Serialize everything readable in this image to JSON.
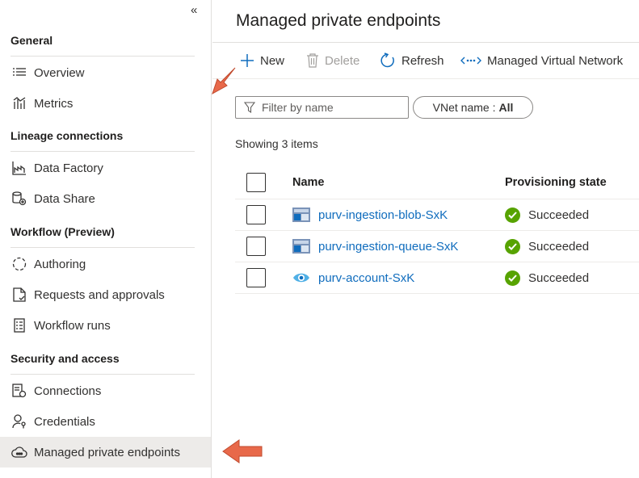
{
  "sidebar": {
    "collapse_glyph": "«",
    "sections": [
      {
        "title": "General"
      },
      {
        "title": "Lineage connections"
      },
      {
        "title": "Workflow (Preview)"
      },
      {
        "title": "Security and access"
      }
    ],
    "items": [
      {
        "label": "Overview",
        "icon": "list-icon"
      },
      {
        "label": "Metrics",
        "icon": "metrics-icon"
      },
      {
        "label": "Data Factory",
        "icon": "data-factory-icon"
      },
      {
        "label": "Data Share",
        "icon": "data-share-icon"
      },
      {
        "label": "Authoring",
        "icon": "authoring-icon"
      },
      {
        "label": "Requests and approvals",
        "icon": "document-icon"
      },
      {
        "label": "Workflow runs",
        "icon": "checklist-icon"
      },
      {
        "label": "Connections",
        "icon": "connections-icon"
      },
      {
        "label": "Credentials",
        "icon": "credentials-icon"
      },
      {
        "label": "Managed private endpoints",
        "icon": "cloud-icon",
        "selected": true
      }
    ]
  },
  "main": {
    "title": "Managed private endpoints",
    "toolbar": {
      "new_label": "New",
      "delete_label": "Delete",
      "refresh_label": "Refresh",
      "vnet_label": "Managed Virtual Network"
    },
    "filter": {
      "placeholder": "Filter by name"
    },
    "vnet_pill": {
      "prefix": "VNet name :",
      "value": "All"
    },
    "showing": "Showing 3 items",
    "table": {
      "columns": [
        "Name",
        "Provisioning state"
      ],
      "rows": [
        {
          "name": "purv-ingestion-blob-SxK",
          "state": "Succeeded",
          "icon": "storage-icon"
        },
        {
          "name": "purv-ingestion-queue-SxK",
          "state": "Succeeded",
          "icon": "storage-icon"
        },
        {
          "name": "purv-account-SxK",
          "state": "Succeeded",
          "icon": "purview-eye-icon"
        }
      ]
    }
  },
  "colors": {
    "accent": "#0f6cbd",
    "success": "#57a300",
    "annotation_arrow": "#e8694a",
    "selected_bg": "#edebe9"
  }
}
